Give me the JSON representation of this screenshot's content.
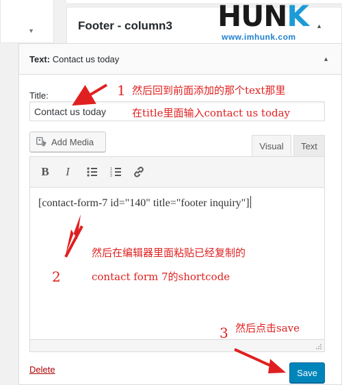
{
  "sidebar": {
    "title": "Footer - column3"
  },
  "logo": {
    "word_part1": "HUN",
    "word_part2": "K",
    "url": "www.imhunk.com"
  },
  "widget": {
    "header_prefix": "Text:",
    "header_title": "Contact us today",
    "title_label": "Title:",
    "title_value": "Contact us today",
    "add_media_label": "Add Media",
    "tabs": [
      {
        "label": "Visual"
      },
      {
        "label": "Text"
      }
    ],
    "toolbar": [
      "bold-icon",
      "italic-icon",
      "bulleted-list-icon",
      "numbered-list-icon",
      "link-icon"
    ],
    "editor_content": "[contact-form-7 id=\"140\" title=\"footer inquiry\"]",
    "delete_label": "Delete",
    "save_label": "Save",
    "accent_color": "#0085ba"
  },
  "annotations": {
    "step1_num": "1",
    "step1_line1": "然后回到前面添加的那个text那里",
    "step1_line2": "在title里面输入contact us today",
    "step2_num": "2",
    "step2_line1": "然后在编辑器里面粘贴已经复制的",
    "step2_line2": "contact form 7的shortcode",
    "step3_num": "3",
    "step3_line1": "然后点击save",
    "color": "#e02020"
  }
}
